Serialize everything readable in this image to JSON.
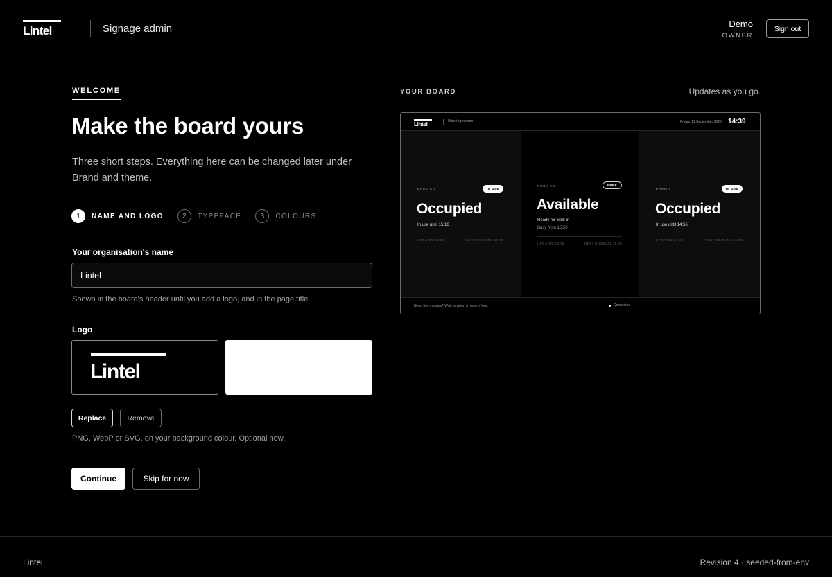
{
  "header": {
    "brand": "Lintel",
    "app_title": "Signage admin",
    "user_name": "Demo",
    "user_role": "OWNER",
    "sign_out_label": "Sign out"
  },
  "onboarding": {
    "eyebrow": "WELCOME",
    "title": "Make the board yours",
    "lede": "Three short steps. Everything here can be changed later under Brand and theme.",
    "steps": [
      {
        "num": "1",
        "label": "NAME AND LOGO",
        "active": true
      },
      {
        "num": "2",
        "label": "TYPEFACE",
        "active": false
      },
      {
        "num": "3",
        "label": "COLOURS",
        "active": false
      }
    ],
    "org_name_label": "Your organisation's name",
    "org_name_value": "Lintel",
    "org_name_hint": "Shown in the board's header until you add a logo, and in the page title.",
    "logo_label": "Logo",
    "logo_wordmark": "Lintel",
    "replace_label": "Replace",
    "remove_label": "Remove",
    "logo_hint": "PNG, WebP or SVG, on your background colour. Optional now.",
    "continue_label": "Continue",
    "skip_label": "Skip for now"
  },
  "preview": {
    "label": "YOUR BOARD",
    "note": "Updates as you go.",
    "board": {
      "brand": "Lintel",
      "location": "Meeting rooms",
      "date": "Friday, 11 September 2026",
      "time": "14:39",
      "rooms": [
        {
          "room": "ROOM 0.4",
          "badge": "IN USE",
          "status": "Occupied",
          "line1": "In use until 15:16",
          "line2": "",
          "updated": "UPDATED 14:38",
          "next": "NEXT BOOKING 17:00"
        },
        {
          "room": "ROOM 0.5",
          "badge": "FREE",
          "status": "Available",
          "line1": "Ready for walk-in",
          "line2": "Busy from 15:50",
          "updated": "UPDATED 14:38",
          "next": "NEXT BOOKING 15:50"
        },
        {
          "room": "ROOM 1.1",
          "badge": "IN USE",
          "status": "Occupied",
          "line1": "In use until 14:56",
          "line2": "",
          "updated": "UPDATED 14:38",
          "next": "NEXT BOOKING 16:30"
        }
      ],
      "footer_message": "Need five minutes? Walk in when a room is free.",
      "connection": "Connected"
    }
  },
  "footer": {
    "brand": "Lintel",
    "revision": "Revision 4 · seeded-from-env"
  },
  "colors": {
    "background": "#000000",
    "foreground": "#ffffff",
    "muted": "#bdbdbd",
    "border": "#6a6a6a"
  }
}
